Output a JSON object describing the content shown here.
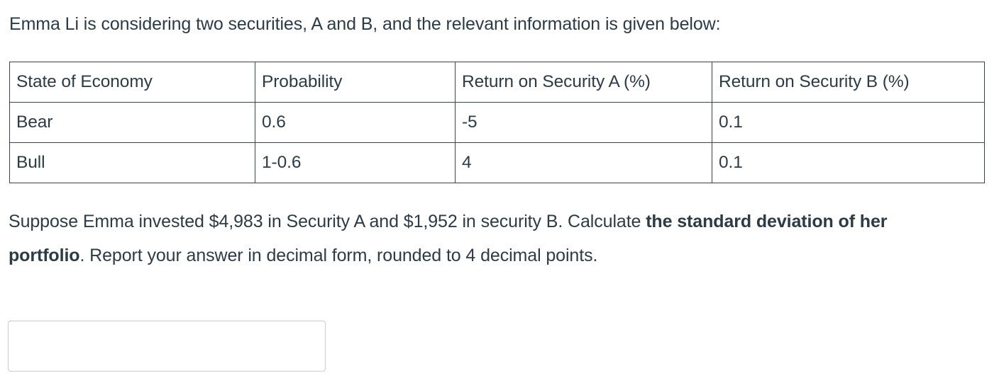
{
  "question_intro": "Emma Li is considering two securities, A and B, and the relevant information is given below:",
  "table": {
    "headers": [
      "State of Economy",
      "Probability",
      "Return on Security A (%)",
      "Return on Security B (%)"
    ],
    "rows": [
      [
        "Bear",
        "0.6",
        "-5",
        "0.1"
      ],
      [
        "Bull",
        "1-0.6",
        "4",
        "0.1"
      ]
    ]
  },
  "prompt": {
    "part1": "Suppose Emma invested $4,983 in Security A and $1,952 in security B. Calculate ",
    "bold1": "the standard deviation of her portfolio",
    "part2": ". Report your answer in decimal form, rounded to 4 decimal points."
  },
  "answer_field": {
    "value": "",
    "placeholder": ""
  },
  "colors": {
    "text": "#2d3b45",
    "table_border": "#3b4449",
    "input_border": "#c7cdd1",
    "background": "#ffffff"
  },
  "chart_data": {
    "type": "table",
    "title": "Securities A and B by State of Economy",
    "columns": [
      "State of Economy",
      "Probability",
      "Return on Security A (%)",
      "Return on Security B (%)"
    ],
    "rows": [
      {
        "state": "Bear",
        "probability": "0.6",
        "return_a_pct": "-5",
        "return_b_pct": "0.1"
      },
      {
        "state": "Bull",
        "probability": "1-0.6",
        "return_a_pct": "4",
        "return_b_pct": "0.1"
      }
    ],
    "investments": {
      "security_a": "$4,983",
      "security_b": "$1,952"
    }
  }
}
